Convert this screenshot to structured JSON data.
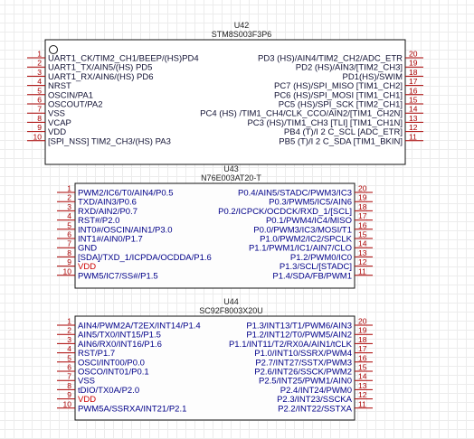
{
  "colors": {
    "body_border": "#111111",
    "body_fill_u42": "#ffffff",
    "body_fill_u43": "#fdfdfd",
    "body_fill_u44": "#fdfdfd",
    "pin_line": "#aa0000",
    "pin_number": "#aa0000",
    "label_text": "#000088",
    "label_text_u42": "#111133",
    "vdd_text": "#cc0000",
    "header_text": "#222222"
  },
  "components": [
    {
      "id": "u42",
      "designator": "U42",
      "part": "STM8S003F3P6",
      "pin1_circle": true,
      "left": [
        {
          "num": "1",
          "label": "UART1_CK/TIM2_CH1/BEEP/(HS)PD4"
        },
        {
          "num": "2",
          "label": "UART1_TX/AIN5/(HS) PD5"
        },
        {
          "num": "3",
          "label": "UART1_RX/AIN6/(HS) PD6"
        },
        {
          "num": "4",
          "label": "NRST"
        },
        {
          "num": "5",
          "label": "OSCIN/PA1"
        },
        {
          "num": "6",
          "label": "OSCOUT/PA2"
        },
        {
          "num": "7",
          "label": "VSS"
        },
        {
          "num": "8",
          "label": "VCAP"
        },
        {
          "num": "9",
          "label": "VDD"
        },
        {
          "num": "10",
          "label": "[SPI_NSS] TIM2_CH3/(HS) PA3"
        }
      ],
      "right": [
        {
          "num": "20",
          "label": "PD3 (HS)/AIN4/TIM2_CH2/ADC_ETR"
        },
        {
          "num": "19",
          "label": "PD2 (HS)/AIN3/[TIM2_CH3]"
        },
        {
          "num": "18",
          "label": "PD1(HS)/SWIM"
        },
        {
          "num": "17",
          "label": "PC7 (HS)/SPI_MISO [TIM1_CH2]"
        },
        {
          "num": "16",
          "label": "PC6 (HS)/SPI_MOSI [TIM1_CH1]"
        },
        {
          "num": "15",
          "label": "PC5 (HS)/SPI_SCK [TIM2_CH1]"
        },
        {
          "num": "14",
          "label": "PC4 (HS) /TIM1_CH4/CLK_CCO/AIN2/[TIM1_CH2N]"
        },
        {
          "num": "13",
          "label": "PC3 (HS)/TIM1_CH3 [TLI] [TIM1_CH1N]"
        },
        {
          "num": "12",
          "label": "PB4 (T)/I 2 C_SCL [ADC_ETR]"
        },
        {
          "num": "11",
          "label": "PB5 (T)/I 2 C_SDA [TIM1_BKIN]"
        }
      ]
    },
    {
      "id": "u43",
      "designator": "U43",
      "part": "N76E003AT20-T",
      "pin1_circle": false,
      "left": [
        {
          "num": "1",
          "label": "PWM2/IC6/T0/AIN4/P0.5"
        },
        {
          "num": "2",
          "label": "TXD/AIN3/P0.6"
        },
        {
          "num": "3",
          "label": "RXD/AIN2/P0.7"
        },
        {
          "num": "4",
          "label": "RST#/P2.0"
        },
        {
          "num": "5",
          "label": "INT0#/OSCIN/AIN1/P3.0"
        },
        {
          "num": "6",
          "label": "INT1#/AIN0/P1.7"
        },
        {
          "num": "7",
          "label": "GND"
        },
        {
          "num": "8",
          "label": "[SDA]/TXD_1/ICPDA/OCDDA/P1.6"
        },
        {
          "num": "9",
          "label": "VDD"
        },
        {
          "num": "10",
          "label": "PWM5/IC7/SS#/P1.5"
        }
      ],
      "right": [
        {
          "num": "20",
          "label": "P0.4/AIN5/STADC/PWM3/IC3"
        },
        {
          "num": "19",
          "label": "P0.3/PWM5/IC5/AIN6"
        },
        {
          "num": "18",
          "label": "P0.2/ICPCK/OCDCK/RXD_1/[SCL]"
        },
        {
          "num": "17",
          "label": "P0.1/PWM4/IC4/MISO"
        },
        {
          "num": "16",
          "label": "P0.0/PWM3/IC3/MOSI/T1"
        },
        {
          "num": "15",
          "label": "P1.0/PWM2/IC2/SPCLK"
        },
        {
          "num": "14",
          "label": "P1.1/PWM1/IC1/AIN7/CLO"
        },
        {
          "num": "13",
          "label": "P1.2/PWM0/IC0"
        },
        {
          "num": "12",
          "label": "P1.3/SCL/[STADC]"
        },
        {
          "num": "11",
          "label": "P1.4/SDA/FB/PWM1"
        }
      ]
    },
    {
      "id": "u44",
      "designator": "U44",
      "part": "SC92F8003X20U",
      "pin1_circle": false,
      "left": [
        {
          "num": "1",
          "label": "AIN4/PWM2A/T2EX/INT14/P1.4"
        },
        {
          "num": "2",
          "label": "AIN5/TX0/INT15/P1.5"
        },
        {
          "num": "3",
          "label": "AIN6/RX0/INT16/P1.6"
        },
        {
          "num": "4",
          "label": "RST/P1.7"
        },
        {
          "num": "5",
          "label": "OSCI/INT00/P0.0"
        },
        {
          "num": "6",
          "label": "OSCO/INT01/P0.1"
        },
        {
          "num": "7",
          "label": "VSS"
        },
        {
          "num": "8",
          "label": "tDIO/TX0A/P2.0"
        },
        {
          "num": "9",
          "label": "VDD"
        },
        {
          "num": "10",
          "label": "PWM5A/SSRXA/INT21/P2.1"
        }
      ],
      "right": [
        {
          "num": "20",
          "label": "P1.3/INT13/T1/PWM6/AIN3"
        },
        {
          "num": "19",
          "label": "P1.2/INT12/T0/PWM5/AIN2"
        },
        {
          "num": "18",
          "label": "P1.1/INT11/T2/RX0A/AIN1/tCLK"
        },
        {
          "num": "17",
          "label": "P1.0/INT10/SSRX/PWM4"
        },
        {
          "num": "16",
          "label": "P2.7/INT27/SSTX/PWM3"
        },
        {
          "num": "15",
          "label": "P2.6/INT26/SSCK/PWM2"
        },
        {
          "num": "14",
          "label": "P2.5/INT25/PWM1/AIN0"
        },
        {
          "num": "13",
          "label": "P2.4/INT24/PWM0"
        },
        {
          "num": "12",
          "label": "P2.3/INT23/SSCKA"
        },
        {
          "num": "11",
          "label": "P2.2/INT22/SSTXA"
        }
      ]
    }
  ]
}
